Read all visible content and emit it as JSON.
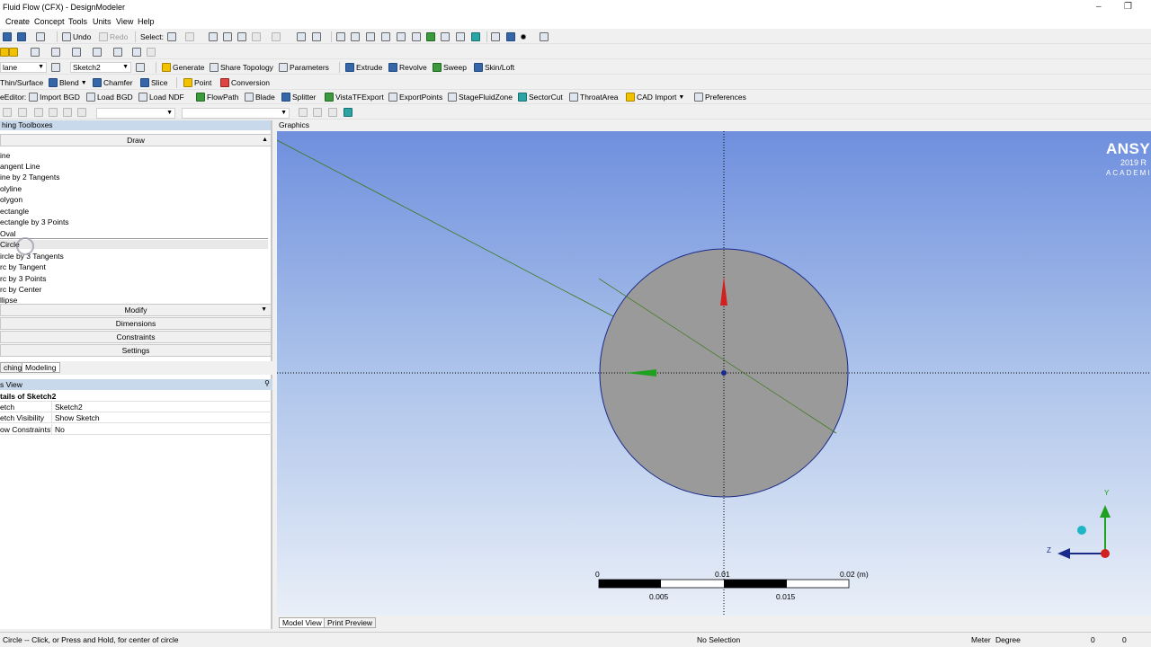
{
  "window": {
    "title": "Fluid Flow (CFX) - DesignModeler",
    "minimize": "–",
    "restore": "❐"
  },
  "menu": [
    "Create",
    "Concept",
    "Tools",
    "Units",
    "View",
    "Help"
  ],
  "toolbar1": {
    "undo": "Undo",
    "redo": "Redo",
    "select": "Select:"
  },
  "toolbar3": {
    "plane": "lane",
    "sketch": "Sketch2",
    "generate": "Generate",
    "share_topology": "Share Topology",
    "parameters": "Parameters",
    "extrude": "Extrude",
    "revolve": "Revolve",
    "sweep": "Sweep",
    "skin_loft": "Skin/Loft"
  },
  "toolbar4": {
    "thin_surface": "Thin/Surface",
    "blend": "Blend",
    "chamfer": "Chamfer",
    "slice": "Slice",
    "point": "Point",
    "conversion": "Conversion"
  },
  "toolbar5": {
    "editor": "eEditor:",
    "import_bgd": "Import BGD",
    "load_bgd": "Load BGD",
    "load_ndf": "Load NDF",
    "flowpath": "FlowPath",
    "blade": "Blade",
    "splitter": "Splitter",
    "vistatfexport": "VistaTFExport",
    "exportpoints": "ExportPoints",
    "stagefluidzone": "StageFluidZone",
    "sectorcut": "SectorCut",
    "throatarea": "ThroatArea",
    "cad_import": "CAD Import",
    "preferences": "Preferences"
  },
  "left_panel": {
    "title": "hing Toolboxes",
    "draw_header": "Draw",
    "draw_items": [
      "ine",
      "angent Line",
      "ine by 2 Tangents",
      "olyline",
      "olygon",
      "ectangle",
      "ectangle by 3 Points",
      "Oval",
      "Circle",
      "ircle by 3 Tangents",
      "rc by Tangent",
      "rc by 3 Points",
      "rc by Center",
      "llipse"
    ],
    "sections": [
      "Modify",
      "Dimensions",
      "Constraints",
      "Settings"
    ],
    "tabs": [
      "ching",
      "Modeling"
    ],
    "details_title": "s View",
    "details_header": "tails of Sketch2",
    "details_rows": [
      {
        "key": "etch",
        "value": "Sketch2"
      },
      {
        "key": "etch Visibility",
        "value": "Show Sketch"
      },
      {
        "key": "ow Constraints?",
        "value": "No"
      }
    ]
  },
  "graphics": {
    "title": "Graphics",
    "logo": {
      "brand": "ANSYS",
      "version": "2019 R",
      "edition": "ACADEMI"
    },
    "scale": {
      "labels_top": [
        "0",
        "0.01",
        "0.02 (m)"
      ],
      "labels_bottom": [
        "0.005",
        "0.015"
      ]
    },
    "triad": {
      "y": "Y",
      "z": "Z"
    },
    "view_tabs": [
      "Model View",
      "Print Preview"
    ]
  },
  "status": {
    "prompt": "Circle -- Click, or Press and Hold, for center of circle",
    "selection": "No Selection",
    "units": "Meter",
    "angle": "Degree",
    "v1": "0",
    "v2": "0"
  }
}
